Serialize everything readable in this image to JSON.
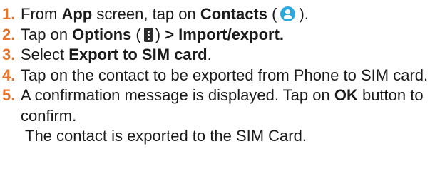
{
  "steps": [
    {
      "num": "1.",
      "p1": "From ",
      "b1": "App",
      "p2": " screen, tap on ",
      "b2": "Contacts",
      "p3": " (",
      "icon": "contacts-person-icon",
      "p4": ")."
    },
    {
      "num": "2.",
      "p1": "Tap on ",
      "b1": "Options",
      "p2": " (",
      "icon": "options-menu-icon",
      "p3": ") ",
      "b2": "> Import/export."
    },
    {
      "num": "3.",
      "p1": "Select ",
      "b1": "Export to SIM card",
      "p2": "."
    },
    {
      "num": "4.",
      "text": "Tap on the contact to be exported from Phone to SIM card."
    },
    {
      "num": "5.",
      "p1": "A confirmation message is displayed. Tap on ",
      "b1": "OK",
      "p2": " button to confirm."
    }
  ],
  "note": "The contact is exported to the SIM Card.",
  "colors": {
    "number": "#e8732a",
    "contacts_icon": "#2aa8e0",
    "options_icon": "#2b2b2b",
    "text": "#1a1a1a"
  }
}
